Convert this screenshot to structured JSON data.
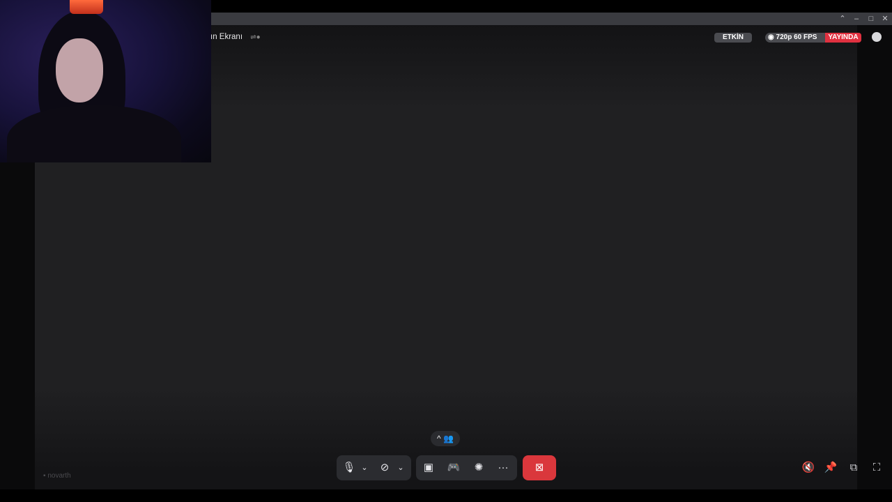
{
  "window": {
    "controls": {
      "restore": "⌃",
      "minimize": "–",
      "maximize": "□",
      "close": "✕"
    }
  },
  "stream": {
    "title": "ın Ekranı",
    "status_badge": "ETKİN",
    "quality_label": "720p 60 FPS",
    "live_label": "YAYINDA"
  },
  "controls": {
    "participants_caret": "^",
    "mic_chevron": "⌄",
    "camera_chevron": "⌄",
    "more_label": "···"
  },
  "footer": {
    "username": "novarth"
  },
  "colors": {
    "live": "#e03140",
    "leave_button": "#da373c",
    "control_bg": "#2b2c30"
  }
}
